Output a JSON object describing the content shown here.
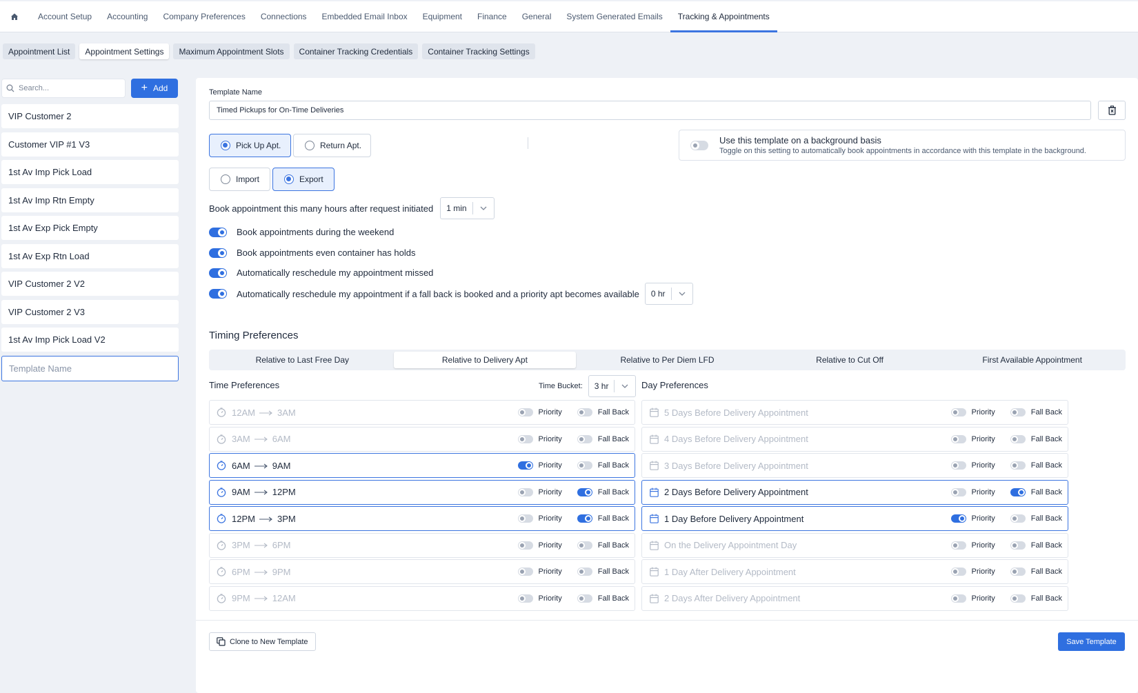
{
  "nav": {
    "tabs": [
      "Account Setup",
      "Accounting",
      "Company Preferences",
      "Connections",
      "Embedded Email Inbox",
      "Equipment",
      "Finance",
      "General",
      "System Generated Emails",
      "Tracking & Appointments"
    ],
    "active_tab": "Tracking & Appointments"
  },
  "subtabs": [
    "Appointment List",
    "Appointment Settings",
    "Maximum Appointment Slots",
    "Container Tracking Credentials",
    "Container Tracking Settings"
  ],
  "sidebar": {
    "search_placeholder": "Search...",
    "add_label": "Add",
    "templates": [
      "VIP Customer 2",
      "Customer VIP #1 V3",
      "1st Av Imp Pick Load",
      "1st Av Imp Rtn Empty",
      "1st Av Exp Pick Empty",
      "1st Av Exp Rtn Load",
      "VIP Customer 2 V2",
      "VIP Customer 2 V3",
      "1st Av Imp Pick Load V2"
    ],
    "new_template_placeholder": "Template Name"
  },
  "form": {
    "template_name_label": "Template Name",
    "template_name_value": "Timed Pickups for On-Time Deliveries",
    "apt_types": [
      {
        "label": "Pick Up Apt.",
        "selected": true
      },
      {
        "label": "Return Apt.",
        "selected": false
      }
    ],
    "directions": [
      {
        "label": "Import",
        "selected": false
      },
      {
        "label": "Export",
        "selected": true
      }
    ],
    "background": {
      "title": "Use this template on a background basis",
      "description": "Toggle on this setting to automatically book appointments in accordance with this template in the background.",
      "enabled": false
    },
    "book_after": {
      "label": "Book appointment this many hours after request initiated",
      "value": "1 min"
    },
    "toggles": [
      {
        "label": "Book appointments during the weekend",
        "on": true
      },
      {
        "label": "Book appointments even container has holds",
        "on": true
      },
      {
        "label": "Automatically reschedule my appointment missed",
        "on": true
      },
      {
        "label": "Automatically reschedule my appointment if a fall back is booked and a priority apt becomes available",
        "on": true,
        "select_value": "0 hr"
      }
    ]
  },
  "timing": {
    "heading": "Timing Preferences",
    "tabs": [
      "Relative to Last Free Day",
      "Relative to Delivery Apt",
      "Relative to Per Diem LFD",
      "Relative to Cut Off",
      "First Available Appointment"
    ],
    "active_tab": "Relative to Delivery Apt",
    "time_heading": "Time Preferences",
    "bucket_label": "Time Bucket:",
    "bucket_value": "3 hr",
    "day_heading": "Day Preferences",
    "priority_label": "Priority",
    "fallback_label": "Fall Back",
    "time_rows": [
      {
        "from": "12AM",
        "to": "3AM",
        "priority": false,
        "fallback": false,
        "active": false
      },
      {
        "from": "3AM",
        "to": "6AM",
        "priority": false,
        "fallback": false,
        "active": false
      },
      {
        "from": "6AM",
        "to": "9AM",
        "priority": true,
        "fallback": false,
        "active": true
      },
      {
        "from": "9AM",
        "to": "12PM",
        "priority": false,
        "fallback": true,
        "active": true
      },
      {
        "from": "12PM",
        "to": "3PM",
        "priority": false,
        "fallback": true,
        "active": true
      },
      {
        "from": "3PM",
        "to": "6PM",
        "priority": false,
        "fallback": false,
        "active": false
      },
      {
        "from": "6PM",
        "to": "9PM",
        "priority": false,
        "fallback": false,
        "active": false
      },
      {
        "from": "9PM",
        "to": "12AM",
        "priority": false,
        "fallback": false,
        "active": false
      }
    ],
    "day_rows": [
      {
        "label": "5 Days Before Delivery Appointment",
        "priority": false,
        "fallback": false,
        "active": false
      },
      {
        "label": "4 Days Before Delivery Appointment",
        "priority": false,
        "fallback": false,
        "active": false
      },
      {
        "label": "3 Days Before Delivery Appointment",
        "priority": false,
        "fallback": false,
        "active": false
      },
      {
        "label": "2 Days Before Delivery Appointment",
        "priority": false,
        "fallback": true,
        "active": true
      },
      {
        "label": "1 Day Before Delivery Appointment",
        "priority": true,
        "fallback": false,
        "active": true
      },
      {
        "label": "On the Delivery Appointment Day",
        "priority": false,
        "fallback": false,
        "active": false
      },
      {
        "label": "1 Day After Delivery Appointment",
        "priority": false,
        "fallback": false,
        "active": false
      },
      {
        "label": "2 Days After Delivery Appointment",
        "priority": false,
        "fallback": false,
        "active": false
      }
    ]
  },
  "actions": {
    "clone_label": "Clone to New Template",
    "save_label": "Save Template"
  },
  "colors": {
    "accent": "#2f6fe0",
    "page_bg": "#eef1f6"
  }
}
